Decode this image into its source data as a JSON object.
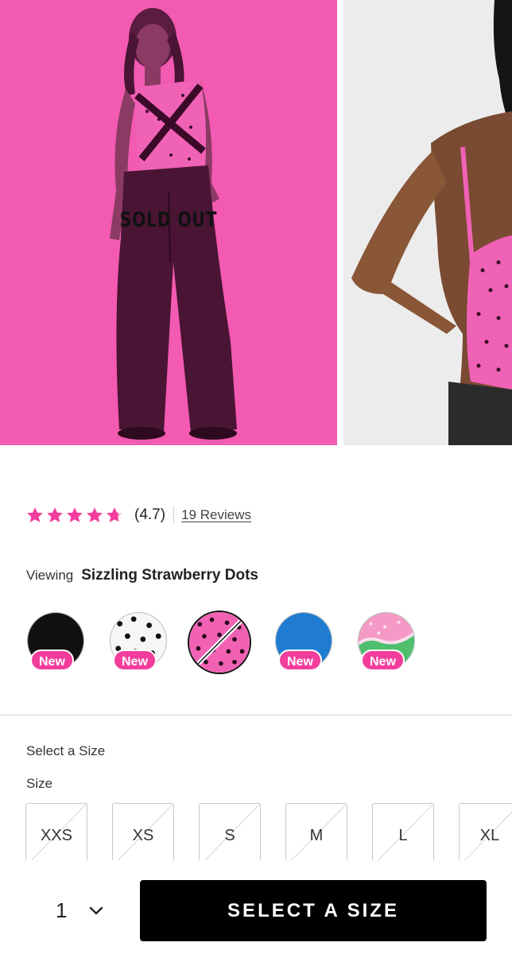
{
  "gallery": {
    "slide_1": {
      "overlay_text": "SOLD OUT",
      "description": "model-front"
    },
    "slide_2": {
      "description": "model-back"
    },
    "progress": 0.25
  },
  "rating": {
    "stars": 4.7,
    "value_text": "(4.7)",
    "reviews_link": "19 Reviews",
    "star_color": "#f33d9c"
  },
  "color": {
    "label": "Viewing",
    "selected_name": "Sizzling Strawberry Dots",
    "swatches": [
      {
        "pattern": "black",
        "badge": "New",
        "selected": false,
        "available": true
      },
      {
        "pattern": "white-black-dots",
        "badge": "New",
        "selected": false,
        "available": true
      },
      {
        "pattern": "pink-black-dots",
        "badge": "",
        "selected": true,
        "available": false
      },
      {
        "pattern": "blue",
        "badge": "New",
        "selected": false,
        "available": true
      },
      {
        "pattern": "pink-lace-green",
        "badge": "New",
        "selected": false,
        "available": true
      }
    ]
  },
  "size": {
    "title": "Select a Size",
    "label": "Size",
    "options": [
      "XXS",
      "XS",
      "S",
      "M",
      "L",
      "XL"
    ]
  },
  "purchase": {
    "quantity": "1",
    "cta_label": "SELECT A SIZE",
    "chevron_icon": "chevron-down-icon"
  },
  "colors": {
    "accent": "#f33d9c",
    "gallery_pink": "#f35ab1",
    "cta": "#000000"
  }
}
